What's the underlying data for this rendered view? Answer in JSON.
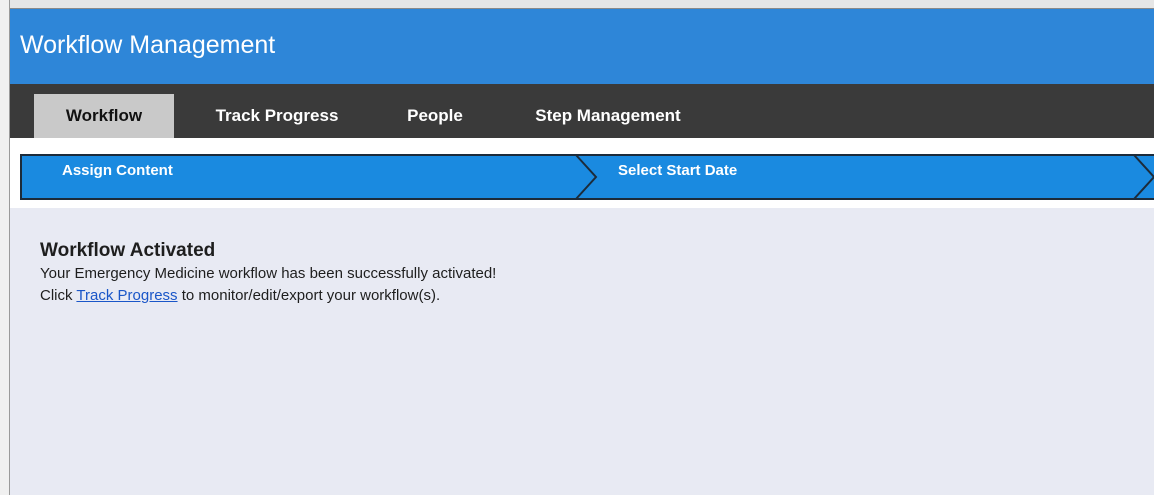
{
  "app": {
    "title": "Workflow Management"
  },
  "nav": {
    "tabs": [
      {
        "label": "Workflow",
        "active": true
      },
      {
        "label": "Track Progress",
        "active": false
      },
      {
        "label": "People",
        "active": false
      },
      {
        "label": "Step Management",
        "active": false
      }
    ]
  },
  "steps": [
    {
      "label": "Assign Content"
    },
    {
      "label": "Select Start Date"
    }
  ],
  "message": {
    "heading": "Workflow Activated",
    "line1": "Your Emergency Medicine workflow has been successfully activated!",
    "line2_prefix": "Click ",
    "line2_link": "Track Progress",
    "line2_suffix": " to monitor/edit/export your workflow(s)."
  },
  "colors": {
    "title_bar": "#2e86d8",
    "nav_bar": "#3a3a3a",
    "active_tab": "#c9c9c9",
    "step_fill": "#1a8ae0",
    "content_bg": "#e8eaf3",
    "link": "#1a56c8"
  }
}
